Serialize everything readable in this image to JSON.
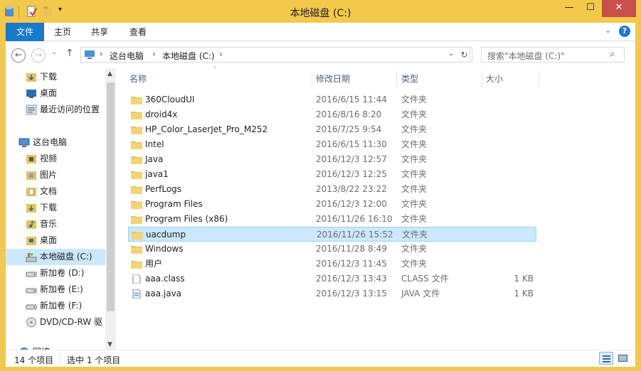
{
  "window": {
    "title": "本地磁盘 (C:)",
    "buttons": {
      "minimize": "—",
      "maximize": "☐",
      "close": "✕"
    }
  },
  "ribbon": {
    "tabs": [
      "文件",
      "主页",
      "共享",
      "查看"
    ],
    "help": "?"
  },
  "address": {
    "breadcrumb": [
      "这台电脑",
      "本地磁盘 (C:)"
    ],
    "search_placeholder": "搜索\"本地磁盘 (C:)\""
  },
  "sidebar": {
    "items": [
      {
        "label": "下载",
        "icon": "download-folder-icon"
      },
      {
        "label": "桌面",
        "icon": "desktop-icon"
      },
      {
        "label": "最近访问的位置",
        "icon": "recent-places-icon"
      },
      {
        "label": "这台电脑",
        "icon": "computer-icon"
      },
      {
        "label": "视频",
        "icon": "videos-folder-icon"
      },
      {
        "label": "图片",
        "icon": "pictures-folder-icon"
      },
      {
        "label": "文档",
        "icon": "documents-folder-icon"
      },
      {
        "label": "下载",
        "icon": "download-folder-icon"
      },
      {
        "label": "音乐",
        "icon": "music-folder-icon"
      },
      {
        "label": "桌面",
        "icon": "desktop-folder-icon"
      },
      {
        "label": "本地磁盘 (C:)",
        "icon": "system-drive-icon"
      },
      {
        "label": "新加卷 (D:)",
        "icon": "drive-icon"
      },
      {
        "label": "新加卷 (E:)",
        "icon": "drive-icon"
      },
      {
        "label": "新加卷 (F:)",
        "icon": "drive-icon"
      },
      {
        "label": "DVD/CD-RW 驱",
        "icon": "dvd-drive-icon"
      },
      {
        "label": "网络",
        "icon": "network-icon"
      }
    ]
  },
  "filelist": {
    "columns": [
      "名称",
      "修改日期",
      "类型",
      "大小"
    ],
    "rows": [
      {
        "name": "360CloudUI",
        "date": "2016/6/15 11:44",
        "type": "文件夹",
        "size": ""
      },
      {
        "name": "droid4x",
        "date": "2016/8/16 8:20",
        "type": "文件夹",
        "size": ""
      },
      {
        "name": "HP_Color_LaserJet_Pro_M252",
        "date": "2016/7/25 9:54",
        "type": "文件夹",
        "size": ""
      },
      {
        "name": "Intel",
        "date": "2016/6/15 11:30",
        "type": "文件夹",
        "size": ""
      },
      {
        "name": "Java",
        "date": "2016/12/3 12:57",
        "type": "文件夹",
        "size": ""
      },
      {
        "name": "java1",
        "date": "2016/12/3 12:25",
        "type": "文件夹",
        "size": ""
      },
      {
        "name": "PerfLogs",
        "date": "2013/8/22 23:22",
        "type": "文件夹",
        "size": ""
      },
      {
        "name": "Program Files",
        "date": "2016/12/3 12:00",
        "type": "文件夹",
        "size": ""
      },
      {
        "name": "Program Files (x86)",
        "date": "2016/11/26 16:10",
        "type": "文件夹",
        "size": ""
      },
      {
        "name": "uacdump",
        "date": "2016/11/26 15:52",
        "type": "文件夹",
        "size": ""
      },
      {
        "name": "Windows",
        "date": "2016/11/28 8:49",
        "type": "文件夹",
        "size": ""
      },
      {
        "name": "用户",
        "date": "2016/12/3 11:45",
        "type": "文件夹",
        "size": ""
      },
      {
        "name": "aaa.class",
        "date": "2016/12/3 13:43",
        "type": "CLASS 文件",
        "size": "1 KB"
      },
      {
        "name": "aaa.java",
        "date": "2016/12/3 13:15",
        "type": "JAVA 文件",
        "size": "1 KB"
      }
    ]
  },
  "status": {
    "item_count": "14 个项目",
    "selected": "选中 1 个项目"
  },
  "colors": {
    "accent": "#1979ca",
    "selection": "#cce8ff",
    "folder": "#e8c15a",
    "titlebar": "#f3c94b"
  }
}
